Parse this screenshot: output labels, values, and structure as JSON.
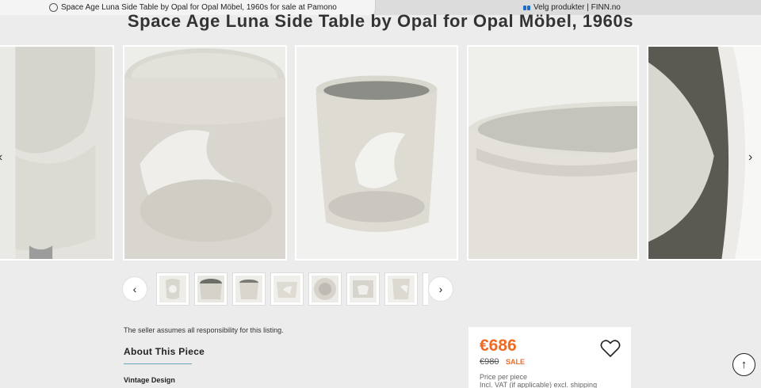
{
  "tabs": {
    "active_title": "Space Age Luna Side Table by Opal for Opal Möbel, 1960s for sale at Pamono",
    "inactive_title": "Velg produkter | FINN.no"
  },
  "listing": {
    "title": "Space Age Luna Side Table by Opal for Opal Möbel, 1960s"
  },
  "carousel": {
    "prev_icon": "‹",
    "next_icon": "›",
    "thumb_prev_icon": "‹",
    "thumb_next_icon": "›"
  },
  "details": {
    "seller_note": "The seller assumes all responsibility for this listing.",
    "about_heading": "About This Piece",
    "design_label": "Vintage Design"
  },
  "pricing": {
    "price": "€686",
    "old_price": "€980",
    "sale_label": "SALE",
    "per_piece": "Price per piece",
    "vat_note": "Incl. VAT (if applicable) excl. shipping"
  },
  "scroll_top_icon": "↑",
  "colors": {
    "accent": "#f06a23",
    "underline": "#6aa6b7",
    "background": "#ececec"
  }
}
